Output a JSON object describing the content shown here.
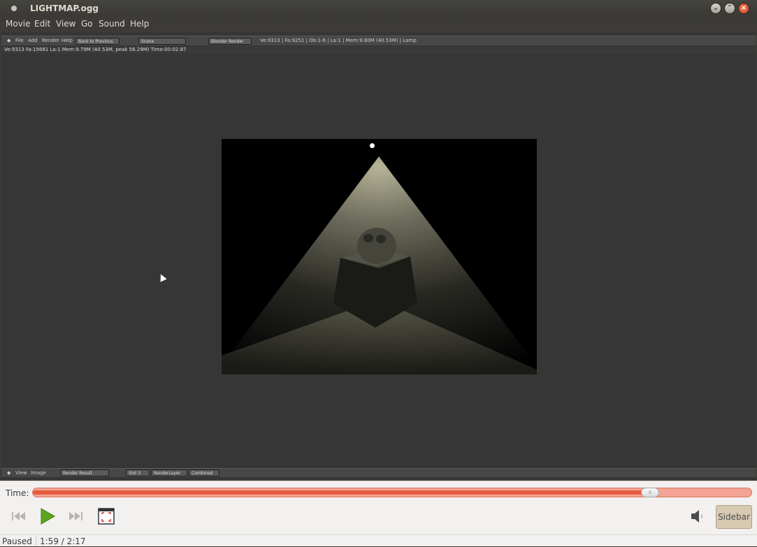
{
  "window": {
    "title": "LIGHTMAP.ogg"
  },
  "menu": [
    "Movie",
    "Edit",
    "View",
    "Go",
    "Sound",
    "Help"
  ],
  "blender": {
    "header_menus": [
      "File",
      "Add",
      "Render",
      "Help"
    ],
    "back_button": "Back to Previous",
    "scene_field": "Scene",
    "engine_field": "Blender Render",
    "header_stats": "Ve:9313 | Fa:9251 | Ob:1-6 | La:1 | Mem:9.80M (40.53M) | Lamp",
    "render_info": "Ve:9313 Fa:15681 La:1 Mem:9.79M (40.53M, peak 56.29M) Time:00:02.87",
    "footer_menus": [
      "View",
      "Image"
    ],
    "image_field": "Render Result",
    "slot": "Slot 3",
    "render_layer": "RenderLayer",
    "pass": "Combined"
  },
  "player": {
    "time_label": "Time:",
    "progress": 0.859,
    "sidebar_label": "Sidebar",
    "status": "Paused",
    "position": "1:59 / 2:17"
  }
}
